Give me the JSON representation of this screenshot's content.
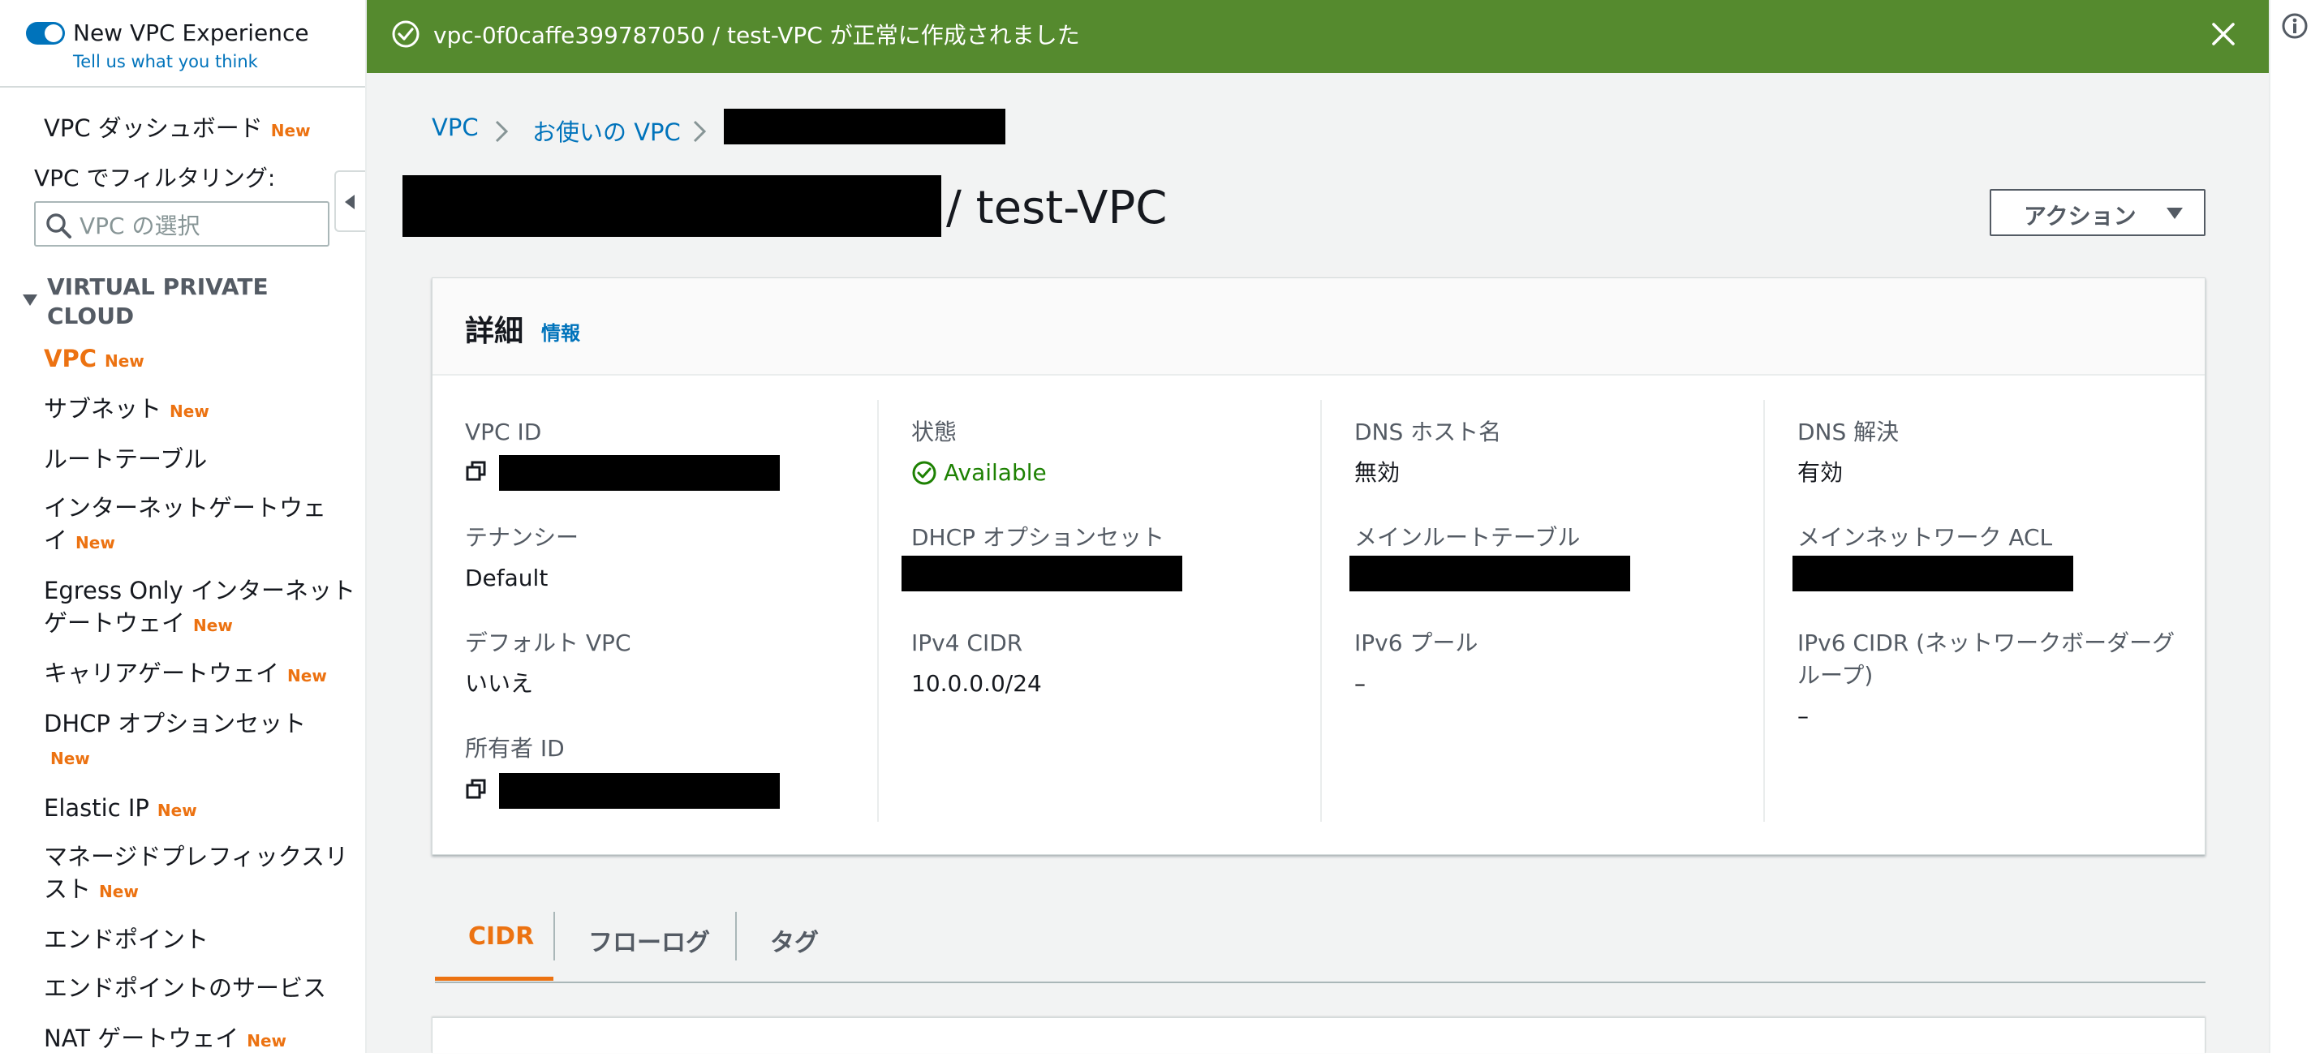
{
  "preview_toggle": {
    "label": "New VPC Experience",
    "feedback_link": "Tell us what you think",
    "enabled": true
  },
  "sidebar": {
    "dashboard_label": "VPC ダッシュボード",
    "new_badge": "New",
    "filter_label": "VPC でフィルタリング:",
    "filter_placeholder": "VPC の選択",
    "section_title_line1": "VIRTUAL PRIVATE",
    "section_title_line2": "CLOUD",
    "items": [
      {
        "label": "VPC",
        "new": true,
        "active": true
      },
      {
        "label": "サブネット",
        "new": true
      },
      {
        "label": "ルートテーブル",
        "new": false
      },
      {
        "label_line1": "インターネットゲートウェ",
        "label_line2": "イ",
        "new": true
      },
      {
        "label_line1": "Egress Only インターネット",
        "label_line2": "ゲートウェイ",
        "new": true
      },
      {
        "label": "キャリアゲートウェイ",
        "new": true
      },
      {
        "label_line1": "DHCP オプションセット",
        "label_line2": "",
        "new": true
      },
      {
        "label": "Elastic IP",
        "new": true
      },
      {
        "label_line1": "マネージドプレフィックスリ",
        "label_line2": "スト",
        "new": true
      },
      {
        "label": "エンドポイント",
        "new": false
      },
      {
        "label": "エンドポイントのサービス",
        "new": false
      },
      {
        "label": "NAT ゲートウェイ",
        "new": true
      }
    ]
  },
  "flash": {
    "message": "vpc-0f0caffe399787050 / test-VPC が正常に作成されました",
    "type": "success"
  },
  "breadcrumb": {
    "items": [
      "VPC",
      "お使いの VPC"
    ]
  },
  "page": {
    "title_suffix": "/ test-VPC",
    "actions_label": "アクション"
  },
  "details": {
    "title": "詳細",
    "info_link": "情報",
    "columns": [
      [
        {
          "key": "VPC ID",
          "value": ""
        },
        {
          "key": "テナンシー",
          "value": "Default"
        },
        {
          "key": "デフォルト VPC",
          "value": "いいえ"
        },
        {
          "key": "所有者 ID",
          "value": ""
        }
      ],
      [
        {
          "key": "状態",
          "value": "Available"
        },
        {
          "key": "DHCP オプションセット",
          "value": ""
        },
        {
          "key": "IPv4 CIDR",
          "value": "10.0.0.0/24"
        }
      ],
      [
        {
          "key": "DNS ホスト名",
          "value": "無効"
        },
        {
          "key": "メインルートテーブル",
          "value": ""
        },
        {
          "key": "IPv6 プール",
          "value": "–"
        }
      ],
      [
        {
          "key": "DNS 解決",
          "value": "有効"
        },
        {
          "key": "メインネットワーク ACL",
          "value": ""
        },
        {
          "key_line1": "IPv6 CIDR (ネットワークボーダーグ",
          "key_line2": "ループ)",
          "value": "–"
        }
      ]
    ]
  },
  "tabs": [
    {
      "label": "CIDR",
      "active": true
    },
    {
      "label": "フローログ",
      "active": false
    },
    {
      "label": "タグ",
      "active": false
    }
  ],
  "colors": {
    "aws_orange": "#ec7211",
    "link_blue": "#0073bb",
    "success_green": "#558a2e",
    "available_green": "#1d8102"
  }
}
